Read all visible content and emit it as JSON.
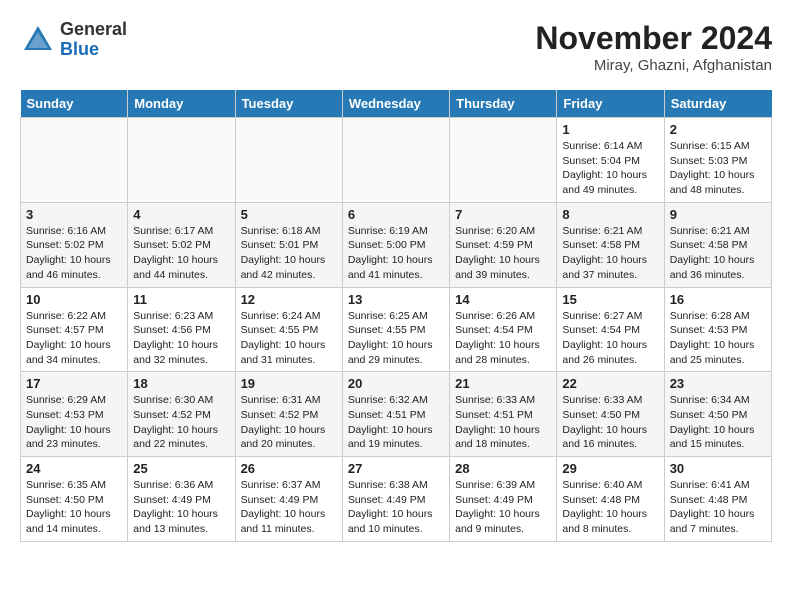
{
  "header": {
    "logo_general": "General",
    "logo_blue": "Blue",
    "month_title": "November 2024",
    "location": "Miray, Ghazni, Afghanistan"
  },
  "weekdays": [
    "Sunday",
    "Monday",
    "Tuesday",
    "Wednesday",
    "Thursday",
    "Friday",
    "Saturday"
  ],
  "weeks": [
    [
      {
        "day": "",
        "info": ""
      },
      {
        "day": "",
        "info": ""
      },
      {
        "day": "",
        "info": ""
      },
      {
        "day": "",
        "info": ""
      },
      {
        "day": "",
        "info": ""
      },
      {
        "day": "1",
        "info": "Sunrise: 6:14 AM\nSunset: 5:04 PM\nDaylight: 10 hours\nand 49 minutes."
      },
      {
        "day": "2",
        "info": "Sunrise: 6:15 AM\nSunset: 5:03 PM\nDaylight: 10 hours\nand 48 minutes."
      }
    ],
    [
      {
        "day": "3",
        "info": "Sunrise: 6:16 AM\nSunset: 5:02 PM\nDaylight: 10 hours\nand 46 minutes."
      },
      {
        "day": "4",
        "info": "Sunrise: 6:17 AM\nSunset: 5:02 PM\nDaylight: 10 hours\nand 44 minutes."
      },
      {
        "day": "5",
        "info": "Sunrise: 6:18 AM\nSunset: 5:01 PM\nDaylight: 10 hours\nand 42 minutes."
      },
      {
        "day": "6",
        "info": "Sunrise: 6:19 AM\nSunset: 5:00 PM\nDaylight: 10 hours\nand 41 minutes."
      },
      {
        "day": "7",
        "info": "Sunrise: 6:20 AM\nSunset: 4:59 PM\nDaylight: 10 hours\nand 39 minutes."
      },
      {
        "day": "8",
        "info": "Sunrise: 6:21 AM\nSunset: 4:58 PM\nDaylight: 10 hours\nand 37 minutes."
      },
      {
        "day": "9",
        "info": "Sunrise: 6:21 AM\nSunset: 4:58 PM\nDaylight: 10 hours\nand 36 minutes."
      }
    ],
    [
      {
        "day": "10",
        "info": "Sunrise: 6:22 AM\nSunset: 4:57 PM\nDaylight: 10 hours\nand 34 minutes."
      },
      {
        "day": "11",
        "info": "Sunrise: 6:23 AM\nSunset: 4:56 PM\nDaylight: 10 hours\nand 32 minutes."
      },
      {
        "day": "12",
        "info": "Sunrise: 6:24 AM\nSunset: 4:55 PM\nDaylight: 10 hours\nand 31 minutes."
      },
      {
        "day": "13",
        "info": "Sunrise: 6:25 AM\nSunset: 4:55 PM\nDaylight: 10 hours\nand 29 minutes."
      },
      {
        "day": "14",
        "info": "Sunrise: 6:26 AM\nSunset: 4:54 PM\nDaylight: 10 hours\nand 28 minutes."
      },
      {
        "day": "15",
        "info": "Sunrise: 6:27 AM\nSunset: 4:54 PM\nDaylight: 10 hours\nand 26 minutes."
      },
      {
        "day": "16",
        "info": "Sunrise: 6:28 AM\nSunset: 4:53 PM\nDaylight: 10 hours\nand 25 minutes."
      }
    ],
    [
      {
        "day": "17",
        "info": "Sunrise: 6:29 AM\nSunset: 4:53 PM\nDaylight: 10 hours\nand 23 minutes."
      },
      {
        "day": "18",
        "info": "Sunrise: 6:30 AM\nSunset: 4:52 PM\nDaylight: 10 hours\nand 22 minutes."
      },
      {
        "day": "19",
        "info": "Sunrise: 6:31 AM\nSunset: 4:52 PM\nDaylight: 10 hours\nand 20 minutes."
      },
      {
        "day": "20",
        "info": "Sunrise: 6:32 AM\nSunset: 4:51 PM\nDaylight: 10 hours\nand 19 minutes."
      },
      {
        "day": "21",
        "info": "Sunrise: 6:33 AM\nSunset: 4:51 PM\nDaylight: 10 hours\nand 18 minutes."
      },
      {
        "day": "22",
        "info": "Sunrise: 6:33 AM\nSunset: 4:50 PM\nDaylight: 10 hours\nand 16 minutes."
      },
      {
        "day": "23",
        "info": "Sunrise: 6:34 AM\nSunset: 4:50 PM\nDaylight: 10 hours\nand 15 minutes."
      }
    ],
    [
      {
        "day": "24",
        "info": "Sunrise: 6:35 AM\nSunset: 4:50 PM\nDaylight: 10 hours\nand 14 minutes."
      },
      {
        "day": "25",
        "info": "Sunrise: 6:36 AM\nSunset: 4:49 PM\nDaylight: 10 hours\nand 13 minutes."
      },
      {
        "day": "26",
        "info": "Sunrise: 6:37 AM\nSunset: 4:49 PM\nDaylight: 10 hours\nand 11 minutes."
      },
      {
        "day": "27",
        "info": "Sunrise: 6:38 AM\nSunset: 4:49 PM\nDaylight: 10 hours\nand 10 minutes."
      },
      {
        "day": "28",
        "info": "Sunrise: 6:39 AM\nSunset: 4:49 PM\nDaylight: 10 hours\nand 9 minutes."
      },
      {
        "day": "29",
        "info": "Sunrise: 6:40 AM\nSunset: 4:48 PM\nDaylight: 10 hours\nand 8 minutes."
      },
      {
        "day": "30",
        "info": "Sunrise: 6:41 AM\nSunset: 4:48 PM\nDaylight: 10 hours\nand 7 minutes."
      }
    ]
  ]
}
